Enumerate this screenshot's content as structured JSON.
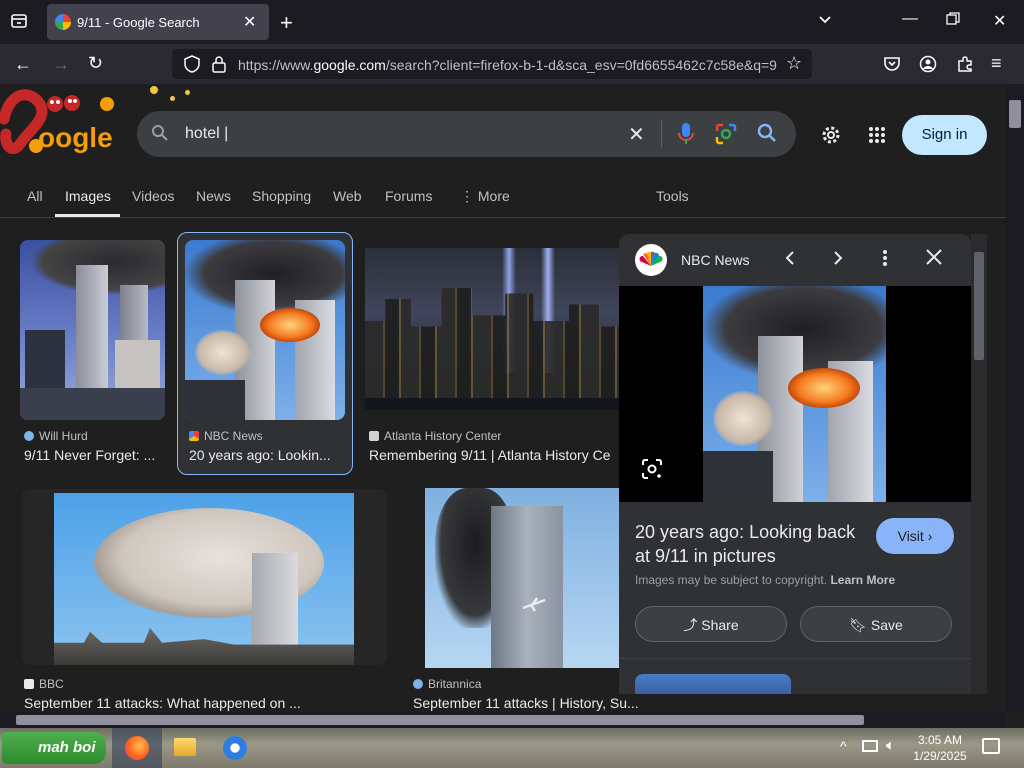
{
  "browser": {
    "tab_title": "9/11 - Google Search",
    "url_prefix": "https://www.",
    "url_domain": "google.com",
    "url_rest": "/search?client=firefox-b-1-d&sca_esv=0fd6655462c7c58e&q=9"
  },
  "search": {
    "query": "hotel |",
    "signin_label": "Sign in"
  },
  "tabs": [
    "All",
    "Images",
    "Videos",
    "News",
    "Shopping",
    "Web",
    "Forums",
    "⋮ More",
    "Tools"
  ],
  "results": [
    {
      "source": "Will Hurd",
      "caption": "9/11 Never Forget: ..."
    },
    {
      "source": "NBC News",
      "caption": "20 years ago: Lookin..."
    },
    {
      "source": "Atlanta History Center",
      "caption": "Remembering 9/11 | Atlanta History Ce"
    },
    {
      "source": "BBC",
      "caption": "September 11 attacks: What happened on ..."
    },
    {
      "source": "Britannica",
      "caption": "September 11 attacks | History, Su..."
    }
  ],
  "panel": {
    "source": "NBC News",
    "title_line1": "20 years ago: Looking back",
    "title_line2": "at 9/11 in pictures",
    "copyright": "Images may be subject to copyright.",
    "learn_more": "Learn More",
    "visit": "Visit",
    "share": "Share",
    "save": "Save"
  },
  "taskbar": {
    "start_label": "mah boi",
    "time": "3:05 AM",
    "date": "1/29/2025"
  },
  "colors": {
    "accent": "#8ab4f8",
    "signin_bg": "#c2e7ff"
  },
  "icons": [
    "tab-list-icon",
    "google-favicon",
    "close-icon",
    "plus-icon",
    "chevron-down-icon",
    "minimize-icon",
    "maximize-icon",
    "back-icon",
    "forward-icon",
    "reload-icon",
    "shield-icon",
    "lock-icon",
    "star-icon",
    "pocket-icon",
    "account-icon",
    "extensions-icon",
    "menu-icon",
    "search-icon",
    "clear-icon",
    "mic-icon",
    "lens-icon",
    "settings-icon",
    "apps-icon",
    "chevron-left-icon",
    "chevron-right-icon",
    "more-vert-icon",
    "share-icon",
    "bookmark-icon",
    "firefox-icon",
    "folder-icon",
    "network-icon",
    "volume-icon",
    "notification-icon"
  ]
}
